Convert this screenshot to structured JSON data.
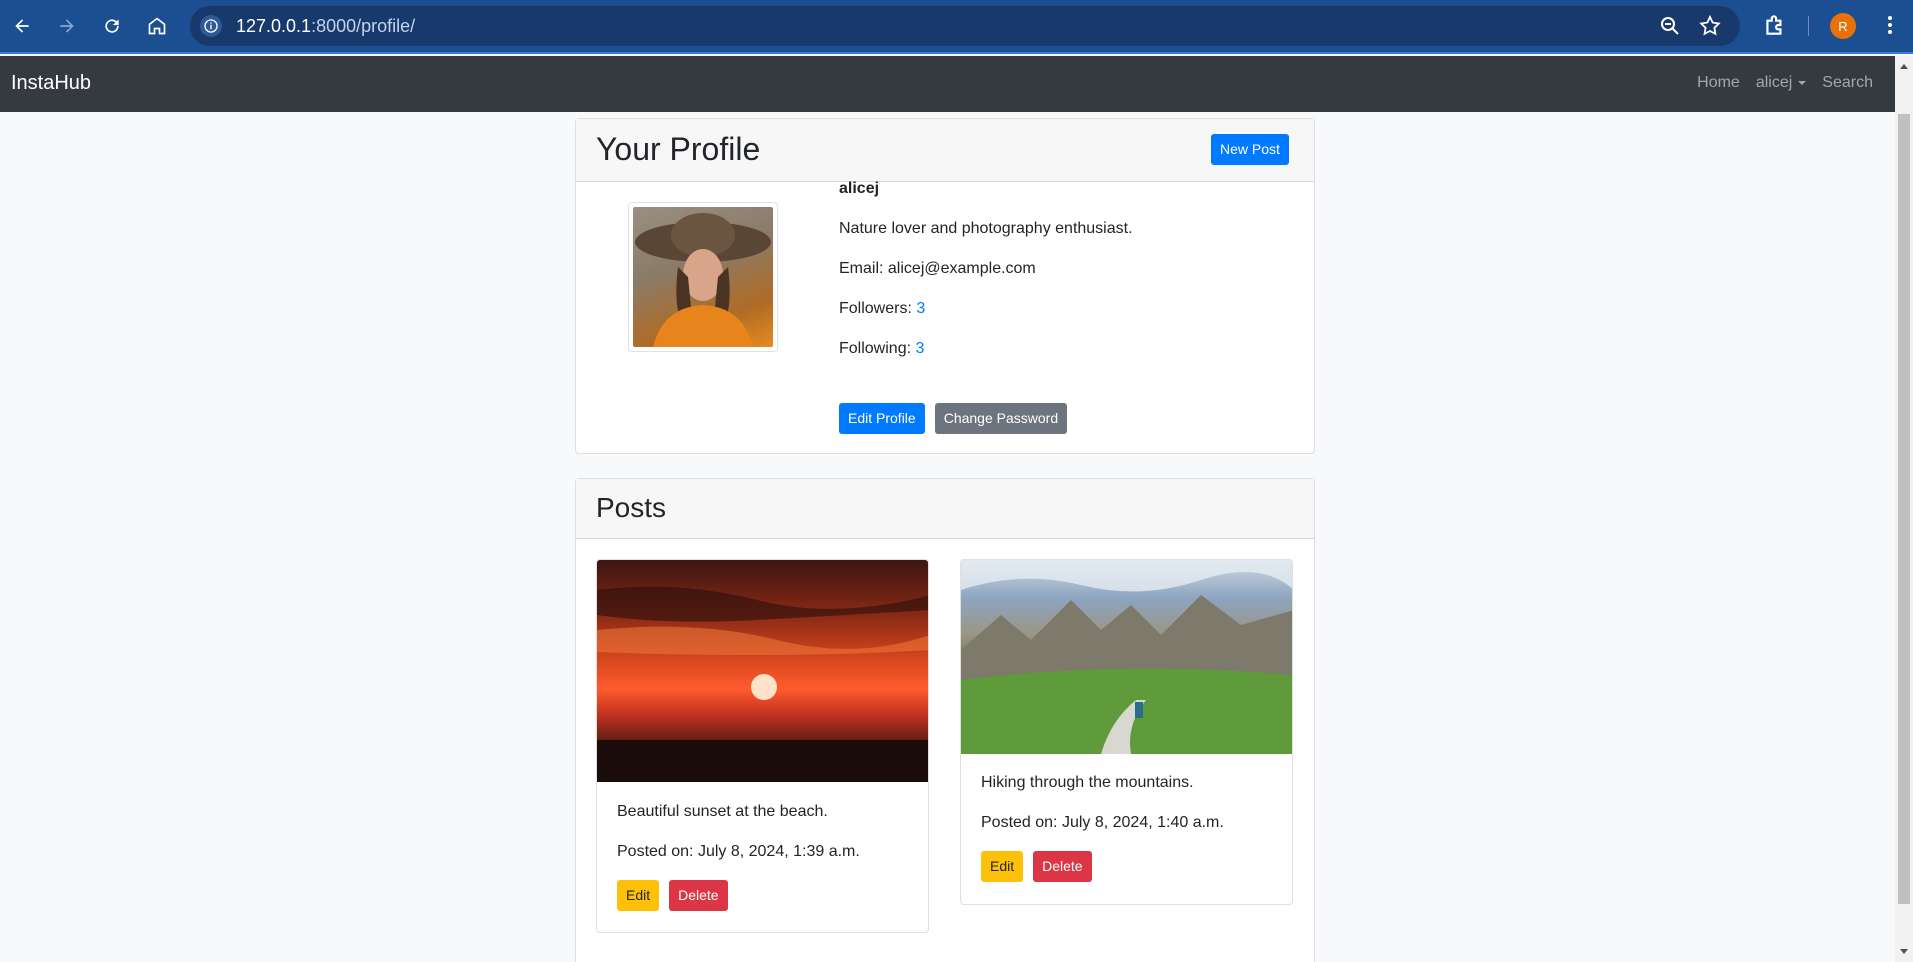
{
  "browser": {
    "url_host": "127.0.0.1",
    "url_rest": ":8000/profile/",
    "profile_initial": "R"
  },
  "nav": {
    "brand": "InstaHub",
    "home": "Home",
    "user": "alicej",
    "search": "Search"
  },
  "profile": {
    "header": "Your Profile",
    "new_post": "New Post",
    "username": "alicej",
    "bio": "Nature lover and photography enthusiast.",
    "email_label": "Email: ",
    "email": "alicej@example.com",
    "followers_label": "Followers: ",
    "followers": "3",
    "following_label": "Following: ",
    "following": "3",
    "edit_profile": "Edit Profile",
    "change_password": "Change Password"
  },
  "posts": {
    "header": "Posts",
    "items": [
      {
        "caption": "Beautiful sunset at the beach.",
        "posted": "Posted on: July 8, 2024, 1:39 a.m.",
        "edit": "Edit",
        "delete": "Delete"
      },
      {
        "caption": "Hiking through the mountains.",
        "posted": "Posted on: July 8, 2024, 1:40 a.m.",
        "edit": "Edit",
        "delete": "Delete"
      }
    ]
  },
  "colors": {
    "primary": "#007bff",
    "secondary": "#6c757d",
    "warning": "#ffc107",
    "danger": "#dc3545",
    "navbar": "#343a40",
    "browser_bar": "#1b4f91"
  }
}
